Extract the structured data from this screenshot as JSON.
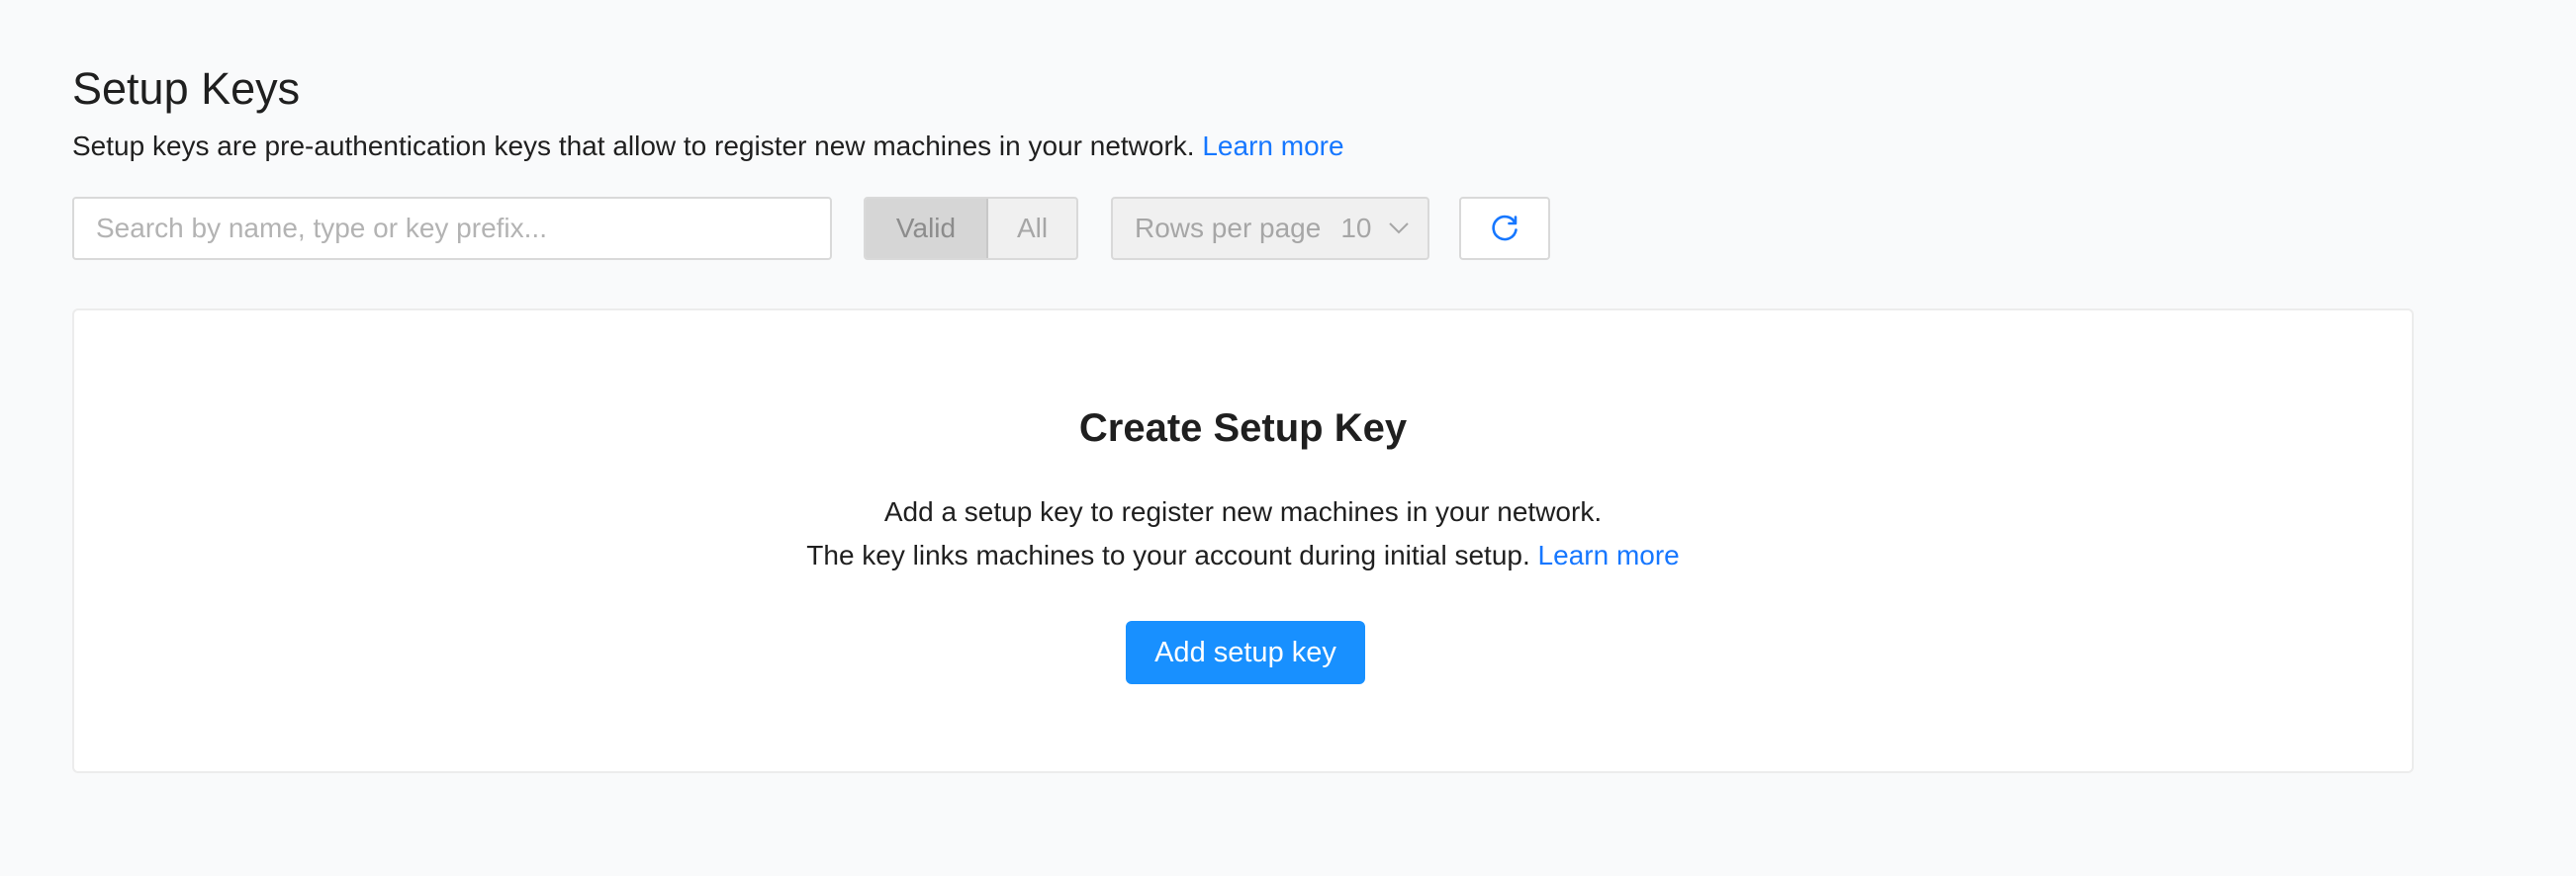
{
  "header": {
    "title": "Setup Keys",
    "description": "Setup keys are pre-authentication keys that allow to register new machines in your network.",
    "learn_more": "Learn more"
  },
  "toolbar": {
    "search_placeholder": "Search by name, type or key prefix...",
    "search_value": "",
    "filter_options": [
      "Valid",
      "All"
    ],
    "filter_selected": "Valid",
    "rows_per_page_label": "Rows per page",
    "rows_per_page_value": "10",
    "chevron_icon": "chevron-down-icon",
    "refresh_icon": "refresh-icon"
  },
  "empty_state": {
    "title": "Create Setup Key",
    "line1": "Add a setup key to register new machines in your network.",
    "line2": "The key links machines to your account during initial setup.",
    "learn_more": "Learn more",
    "button_label": "Add setup key"
  },
  "colors": {
    "accent": "#1890ff",
    "link": "#1677ff",
    "background": "#f9fafb"
  }
}
